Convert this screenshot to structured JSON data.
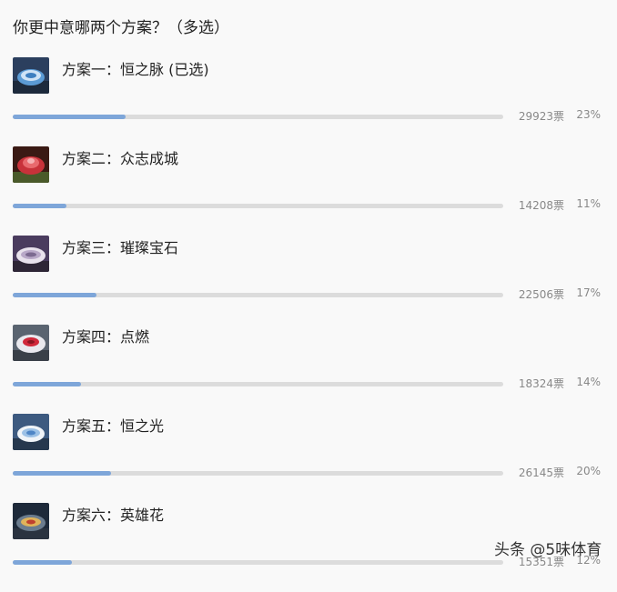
{
  "question": "你更中意哪两个方案？（多选）",
  "options": [
    {
      "label": "方案一：恒之脉 (已选)",
      "votes": "29923票",
      "percent": "23%",
      "fill": 0.23,
      "thumb": "stadium-blue-icon"
    },
    {
      "label": "方案二：众志成城",
      "votes": "14208票",
      "percent": "11%",
      "fill": 0.11,
      "thumb": "stadium-red-icon"
    },
    {
      "label": "方案三：璀璨宝石",
      "votes": "22506票",
      "percent": "17%",
      "fill": 0.17,
      "thumb": "stadium-night-icon"
    },
    {
      "label": "方案四：点燃",
      "votes": "18324票",
      "percent": "14%",
      "fill": 0.14,
      "thumb": "stadium-red-top-icon"
    },
    {
      "label": "方案五：恒之光",
      "votes": "26145票",
      "percent": "20%",
      "fill": 0.2,
      "thumb": "stadium-white-icon"
    },
    {
      "label": "方案六：英雄花",
      "votes": "15351票",
      "percent": "12%",
      "fill": 0.12,
      "thumb": "stadium-lit-icon"
    }
  ],
  "watermark": "头条 @5味体育",
  "colors": {
    "bar_fill": "#7ea6d9",
    "bar_track": "#dcdcdc",
    "text": "#222222",
    "muted": "#888888"
  }
}
